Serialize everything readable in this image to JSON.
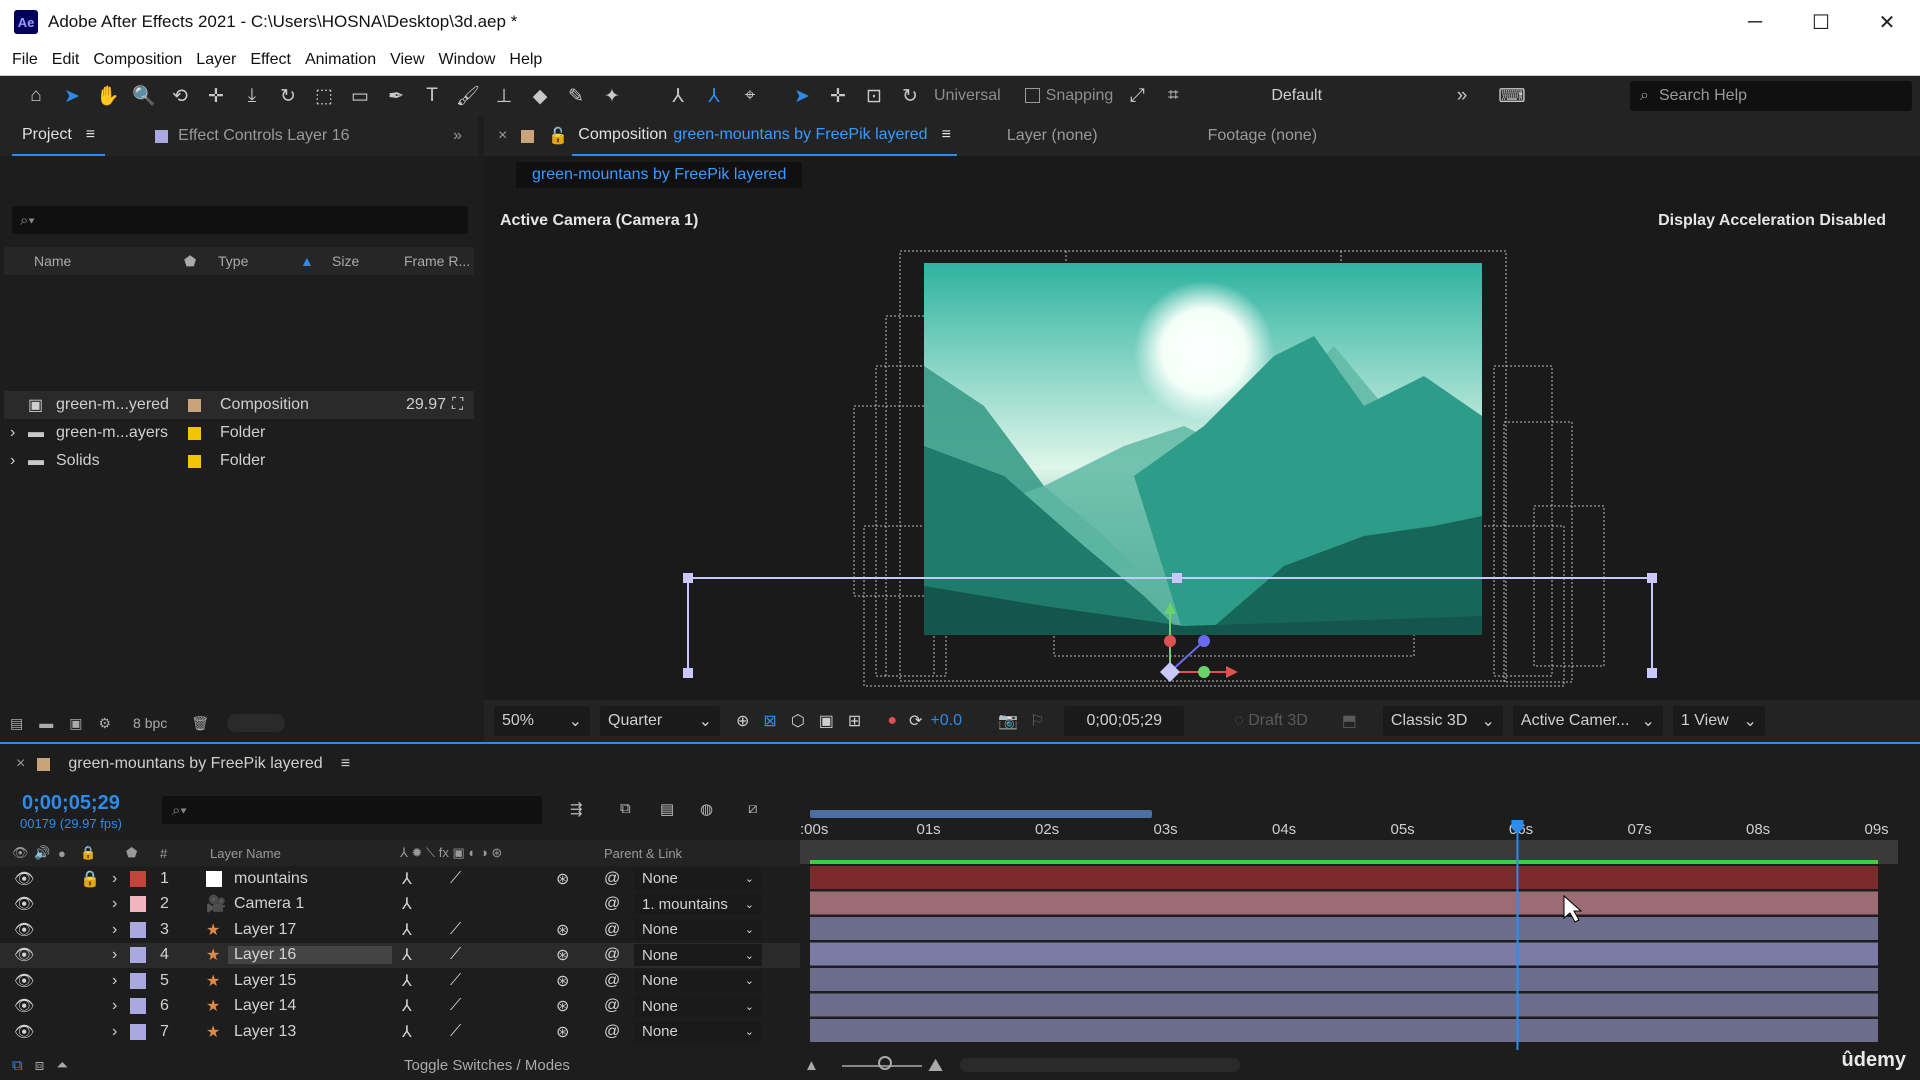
{
  "window": {
    "title": "Adobe After Effects 2021 - C:\\Users\\HOSNA\\Desktop\\3d.aep *",
    "logo": "Ae"
  },
  "menu": [
    "File",
    "Edit",
    "Composition",
    "Layer",
    "Effect",
    "Animation",
    "View",
    "Window",
    "Help"
  ],
  "toolbar": {
    "universal": "Universal",
    "snapping": "Snapping",
    "workspace": "Default",
    "search_placeholder": "Search Help"
  },
  "project_panel": {
    "tabs": [
      "Project",
      "Effect Controls Layer 16"
    ],
    "columns": [
      "Name",
      "Type",
      "Size",
      "Frame R..."
    ],
    "items": [
      {
        "name": "green-m...yered",
        "type": "Composition",
        "frame_rate": "29.97",
        "color": "#c9a37a"
      },
      {
        "name": "green-m...ayers",
        "type": "Folder",
        "frame_rate": "",
        "color": "#f2c500"
      },
      {
        "name": "Solids",
        "type": "Folder",
        "frame_rate": "",
        "color": "#f2c500"
      }
    ],
    "bpc": "8 bpc"
  },
  "viewer": {
    "tab_label": "Composition",
    "comp_name": "green-mountans by FreePik layered",
    "other_tabs": [
      "Layer (none)",
      "Footage (none)"
    ],
    "sub_tab": "green-mountans by FreePik layered",
    "camera_label": "Active Camera (Camera 1)",
    "accel_label": "Display Acceleration Disabled",
    "zoom": "50%",
    "resolution": "Quarter",
    "exposure": "+0.0",
    "timecode": "0;00;05;29",
    "draft3d": "Draft 3D",
    "renderer": "Classic 3D",
    "camera": "Active Camer...",
    "views": "1 View"
  },
  "timeline": {
    "comp_name": "green-mountans by FreePik layered",
    "timecode": "0;00;05;29",
    "frame_info": "00179 (29.97 fps)",
    "col_layer_name": "Layer Name",
    "col_parent": "Parent & Link",
    "col_hash": "#",
    "ruler": [
      ":00s",
      "01s",
      "02s",
      "03s",
      "04s",
      "05s",
      "06s",
      "07s",
      "08s",
      "09s"
    ],
    "playhead_seconds": 5.97,
    "layers": [
      {
        "num": "1",
        "name": "mountains",
        "parent": "None",
        "label_color": "#c4443c",
        "selected": false
      },
      {
        "num": "2",
        "name": "Camera 1",
        "parent": "1. mountains",
        "label_color": "#f2b5c0",
        "selected": false
      },
      {
        "num": "3",
        "name": "Layer 17",
        "parent": "None",
        "label_color": "#a9a9e0",
        "selected": false
      },
      {
        "num": "4",
        "name": "Layer 16",
        "parent": "None",
        "label_color": "#a9a9e0",
        "selected": true
      },
      {
        "num": "5",
        "name": "Layer 15",
        "parent": "None",
        "label_color": "#a9a9e0",
        "selected": false
      },
      {
        "num": "6",
        "name": "Layer 14",
        "parent": "None",
        "label_color": "#a9a9e0",
        "selected": false
      },
      {
        "num": "7",
        "name": "Layer 13",
        "parent": "None",
        "label_color": "#a9a9e0",
        "selected": false
      }
    ],
    "toggle_label": "Toggle Switches / Modes"
  },
  "watermark": "ûdemy",
  "colors": {
    "accent": "#2d8ceb",
    "track_red": "#7a2a2a",
    "track_pink": "#9c6b73",
    "track_purple": "#6c6c8c"
  }
}
